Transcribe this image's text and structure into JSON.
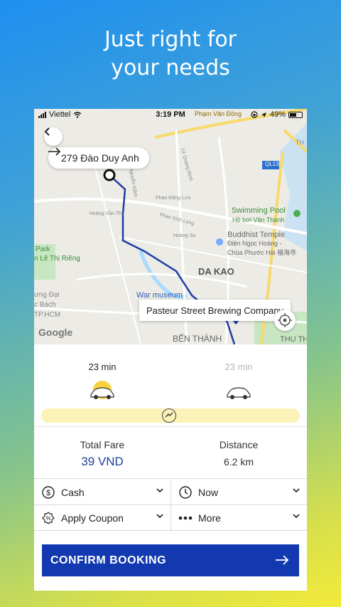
{
  "headline": {
    "line1": "Just right for",
    "line2": "your needs"
  },
  "status_bar": {
    "carrier": "Viettel",
    "time": "3:19 PM",
    "battery": "49%"
  },
  "map": {
    "pickup_address": "279 Đào Duy Anh",
    "destination": "Pasteur Street Brewing Company",
    "labels": {
      "pham_van_dong": "Phạm Văn Đồng",
      "swimming_pool": "Swimming Pool",
      "swimming_pool_sub": "Hồ bơi Văn Thánh",
      "buddhist_temple": "Buddhist Temple",
      "buddhist_temple_sub1": "Điện Ngọc Hoàng -",
      "buddhist_temple_sub2": "Chùa Phước Hải 福海寺",
      "da_kao": "DA KAO",
      "war_museum": "War museum",
      "ben_thanh": "BẾN THÀNH",
      "thu_thiem": "THU TH",
      "park": "Park",
      "le_thi_rieng": "n Lê Thị Riêng",
      "ql13": "QL13",
      "ung_dai": "ưng Đại",
      "c_bach": "c Bách",
      "tp_hcm": "TP.HCM",
      "google": "Google",
      "th": "TH",
      "hoang_van_thu": "Hoàng Văn Thụ",
      "nguyen_kiem": "Nguyễn Kiệm",
      "phan_dang_luu": "Phan Đăng Lưu",
      "phan_xich_long": "Phan Xích Long",
      "hoang_sa": "Hoàng Sa",
      "le_quang_dinh": "Lê Quang Định"
    }
  },
  "vehicles": [
    {
      "time": "23 min",
      "selected": true,
      "icon": "taxi-icon"
    },
    {
      "time": "23 min",
      "selected": false,
      "icon": "car-icon"
    }
  ],
  "fare": {
    "total_label": "Total Fare",
    "total_value": "39 VND",
    "distance_label": "Distance",
    "distance_value": "6.2 km"
  },
  "options": {
    "payment": "Cash",
    "time": "Now",
    "coupon": "Apply Coupon",
    "more": "More"
  },
  "confirm_label": "CONFIRM BOOKING",
  "colors": {
    "brand_blue": "#1239b0",
    "route_blue": "#1c3ea6",
    "track_yellow": "#fbf2b8"
  }
}
